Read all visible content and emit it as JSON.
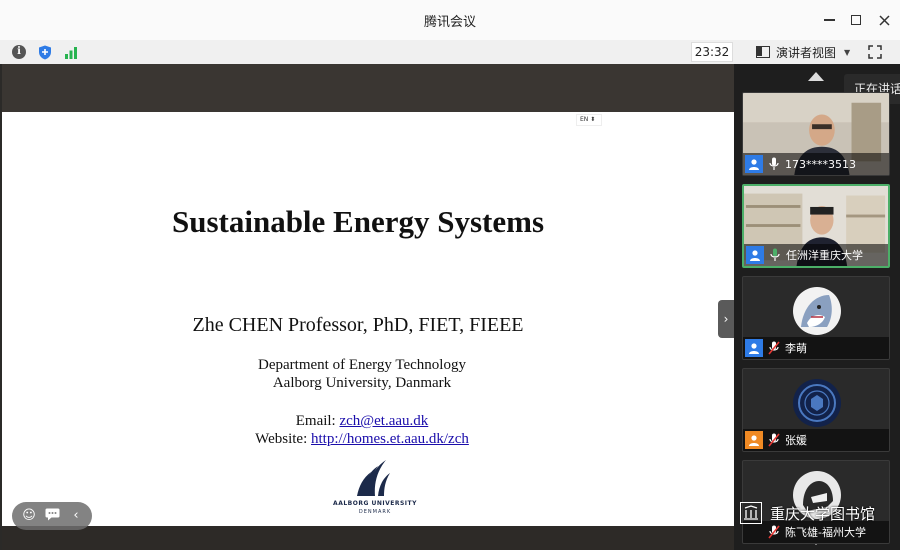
{
  "app": {
    "title": "腾讯会议"
  },
  "toolbar": {
    "timer": "23:32",
    "view_label": "演讲者视图"
  },
  "slide": {
    "lang": "EN",
    "title": "Sustainable Energy Systems",
    "author": "Zhe CHEN  Professor, PhD, FIET, FIEEE",
    "dept_line1": "Department of Energy Technology",
    "dept_line2": "Aalborg University, Danmark",
    "email_label": "Email: ",
    "email": "zch@et.aau.dk",
    "website_label": "Website: ",
    "website": "http://homes.et.aau.dk/zch",
    "logo_name": "AALBORG UNIVERSITY",
    "logo_country": "DENMARK"
  },
  "panel": {
    "speaking_tip": "正在讲话",
    "participants": [
      {
        "name": "173****3513"
      },
      {
        "name": "任洲洋重庆大学"
      },
      {
        "name": "李萌"
      },
      {
        "name": "张媛"
      },
      {
        "name": "陈飞雄-福州大学"
      }
    ]
  },
  "watermark": {
    "text": "重庆大学图书馆"
  },
  "colors": {
    "active_border": "#4caf68",
    "mic_active": "#4caf68",
    "avatar_blue": "#2e7be6",
    "avatar_orange": "#f08a24"
  }
}
